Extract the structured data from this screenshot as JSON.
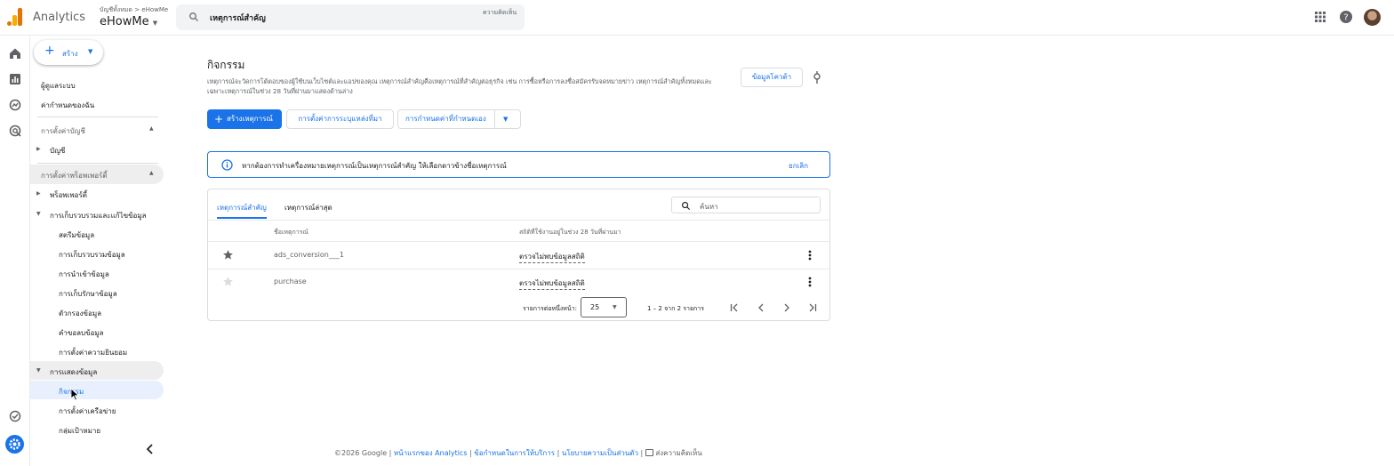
{
  "header": {
    "app_name": "Analytics",
    "account_path": "บัญชีทั้งหมด > eHowMe",
    "account_name": "eHowMe",
    "search_value": "เหตุการณ์สำคัญ",
    "search_hint": "ความคิดเห็น",
    "icons": [
      "apps-grid-icon",
      "help-icon",
      "avatar"
    ]
  },
  "rail": {
    "icons": [
      "home-icon",
      "reports-icon",
      "explore-icon",
      "advertising-icon",
      "configure-icon",
      "admin-gear-icon"
    ]
  },
  "sidebar": {
    "create_label": "สร้าง",
    "user_management": "ผู้ดูแลระบบ",
    "my_settings": "ค่ากำหนดของฉัน",
    "account_settings_section": "การตั้งค่าบัญชี",
    "account_item": "บัญชี",
    "property_settings_section": "การตั้งค่าพร็อพเพอร์ตี้",
    "property_item": "พร็อพเพอร์ตี้",
    "data_collection_group": "การเก็บรวบรวมและแก้ไขข้อมูล",
    "data_collection_items": [
      "สตรีมข้อมูล",
      "การเก็บรวบรวมข้อมูล",
      "การนำเข้าข้อมูล",
      "การเก็บรักษาข้อมูล",
      "ตัวกรองข้อมูล",
      "คำขอลบข้อมูล",
      "การตั้งค่าความยินยอม"
    ],
    "data_display_group": "การแสดงข้อมูล",
    "data_display_items": [
      "กิจกรรม",
      "การตั้งค่าเครือข่าย",
      "กลุ่มเป้าหมาย"
    ]
  },
  "main": {
    "title": "กิจกรรม",
    "description": "เหตุการณ์จะวัดการโต้ตอบของผู้ใช้บนเว็บไซต์และแอปของคุณ เหตุการณ์สำคัญคือเหตุการณ์ที่สำคัญต่อธุรกิจ เช่น การซื้อหรือการลงชื่อสมัครรับจดหมายข่าว เหตุการณ์สำคัญทั้งหมดและเฉพาะเหตุการณ์ในช่วง 28 วันที่ผ่านมาแสดงด้านล่าง",
    "customer_data_button": "ข้อมูลโควต้า",
    "create_event_button": "สร้างเหตุการณ์",
    "modify_button": "การตั้งค่าการระบุแหล่งที่มา",
    "custom_button": "การกำหนดค่าที่กำหนดเอง",
    "banner_text": "หากต้องการทำเครื่องหมายเหตุการณ์เป็นเหตุการณ์สำคัญ ให้เลือกดาวข้างชื่อเหตุการณ์",
    "banner_dismiss": "ยกเลิก"
  },
  "table": {
    "tabs": [
      "เหตุการณ์สำคัญ",
      "เหตุการณ์ล่าสุด"
    ],
    "search_placeholder": "ค้นหา",
    "col_name": "ชื่อเหตุการณ์",
    "col_status": "สถิติที่ใช้งานอยู่ในช่วง 28 วันที่ผ่านมา",
    "rows": [
      {
        "name": "ads_conversion___1",
        "status": "ตรวจไม่พบข้อมูลสถิติ",
        "starred": true
      },
      {
        "name": "purchase",
        "status": "ตรวจไม่พบข้อมูลสถิติ",
        "starred": false
      }
    ],
    "rows_per_page_label": "รายการต่อหนึ่งหน้า:",
    "rows_per_page_value": "25",
    "range_text": "1 – 2 จาก 2 รายการ"
  },
  "footer": {
    "copyright": "©2026 Google |",
    "link_home": "หน้าแรกของ Analytics",
    "sep1": "|",
    "link_terms": "ข้อกำหนดในการให้บริการ",
    "sep2": "|",
    "link_privacy": "นโยบายความเป็นส่วนตัว",
    "sep3": "|",
    "feedback": "ส่งความคิดเห็น"
  },
  "colors": {
    "accent": "#1a73e8",
    "selected_bg": "#e8f0fe",
    "group_bg": "#eeeeee",
    "star_gray": "#5f6368"
  }
}
